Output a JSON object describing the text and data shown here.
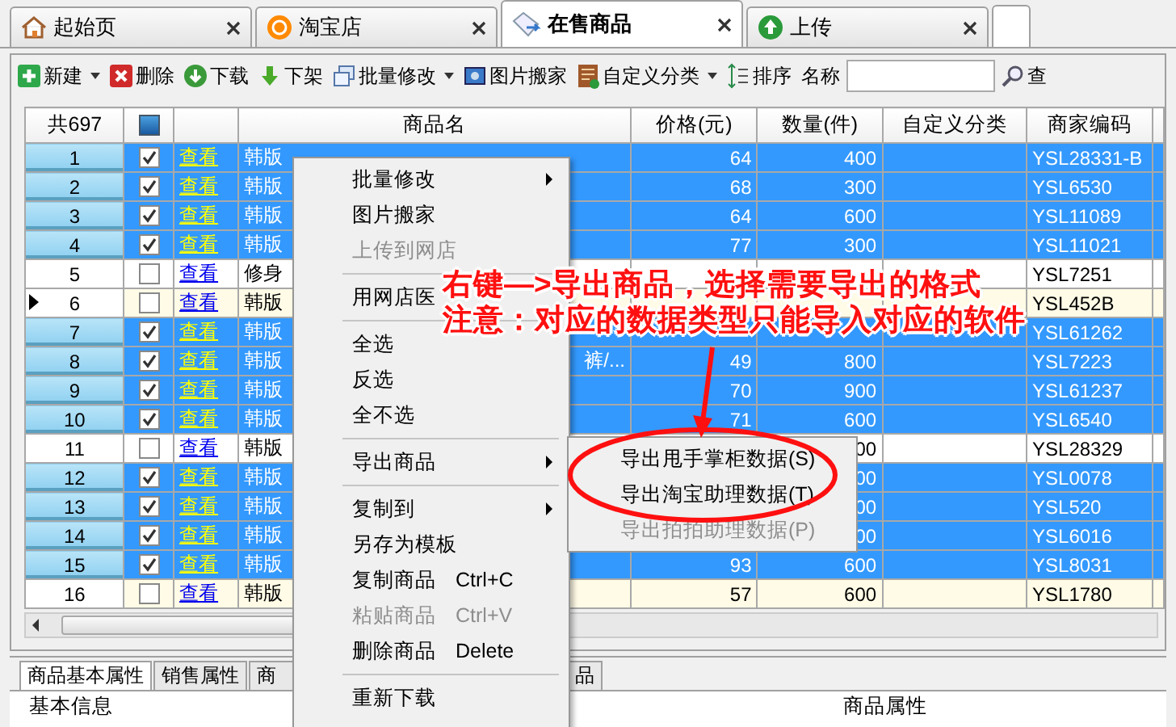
{
  "tabs": [
    {
      "label": "起始页",
      "kind": "home",
      "selected": false
    },
    {
      "label": "淘宝店",
      "kind": "shop",
      "selected": false
    },
    {
      "label": "在售商品",
      "kind": "tag",
      "selected": true
    },
    {
      "label": "上传",
      "kind": "upload",
      "selected": false
    }
  ],
  "toolbar": {
    "buttons": [
      {
        "label": "新建",
        "kind": "new",
        "dropdown": true
      },
      {
        "label": "删除",
        "kind": "delete",
        "dropdown": false
      },
      {
        "label": "下载",
        "kind": "download",
        "dropdown": false
      },
      {
        "label": "下架",
        "kind": "down",
        "dropdown": false
      },
      {
        "label": "批量修改",
        "kind": "batch",
        "dropdown": true
      },
      {
        "label": "图片搬家",
        "kind": "picture",
        "dropdown": false
      },
      {
        "label": "自定义分类",
        "kind": "category",
        "dropdown": true
      },
      {
        "label": "排序",
        "kind": "sort",
        "dropdown": false
      }
    ],
    "search_label": "名称",
    "search_button": "查"
  },
  "grid": {
    "total": "共697",
    "select_all_checked": true,
    "columns": [
      "商品名",
      "价格(元)",
      "数量(件)",
      "自定义分类",
      "商家编码"
    ],
    "rows": [
      {
        "no": "1",
        "checked": true,
        "selected": true,
        "current": false,
        "view": "查看",
        "name": "韩版",
        "price": "64",
        "qty": "400",
        "code": "YSL28331-B"
      },
      {
        "no": "2",
        "checked": true,
        "selected": true,
        "current": false,
        "view": "查看",
        "name": "韩版",
        "price": "68",
        "qty": "300",
        "code": "YSL6530"
      },
      {
        "no": "3",
        "checked": true,
        "selected": true,
        "current": false,
        "view": "查看",
        "name": "韩版",
        "price": "64",
        "qty": "600",
        "code": "YSL11089"
      },
      {
        "no": "4",
        "checked": true,
        "selected": true,
        "current": false,
        "view": "查看",
        "name": "韩版",
        "price": "77",
        "qty": "300",
        "code": "YSL11021"
      },
      {
        "no": "5",
        "checked": false,
        "selected": false,
        "current": false,
        "view": "查看",
        "name": "修身",
        "code": "YSL7251"
      },
      {
        "no": "6",
        "checked": false,
        "selected": false,
        "current": true,
        "view": "查看",
        "name": "韩版",
        "code": "YSL452B"
      },
      {
        "no": "7",
        "checked": true,
        "selected": true,
        "current": false,
        "view": "查看",
        "name": "韩版",
        "code": "YSL61262"
      },
      {
        "no": "8",
        "checked": true,
        "selected": true,
        "current": false,
        "view": "查看",
        "name": "韩版",
        "name_end": "裤/...",
        "price": "49",
        "qty": "800",
        "code": "YSL7223"
      },
      {
        "no": "9",
        "checked": true,
        "selected": true,
        "current": false,
        "view": "查看",
        "name": "韩版",
        "price": "70",
        "qty": "900",
        "code": "YSL61237"
      },
      {
        "no": "10",
        "checked": true,
        "selected": true,
        "current": false,
        "view": "查看",
        "name": "韩版",
        "price": "71",
        "qty": "600",
        "code": "YSL6540"
      },
      {
        "no": "11",
        "checked": false,
        "selected": false,
        "current": false,
        "view": "查看",
        "name": "韩版",
        "qty": "00",
        "code": "YSL28329"
      },
      {
        "no": "12",
        "checked": true,
        "selected": true,
        "current": false,
        "view": "查看",
        "name": "韩版",
        "qty": "00",
        "code": "YSL0078"
      },
      {
        "no": "13",
        "checked": true,
        "selected": true,
        "current": false,
        "view": "查看",
        "name": "韩版",
        "qty": "00",
        "code": "YSL520"
      },
      {
        "no": "14",
        "checked": true,
        "selected": true,
        "current": false,
        "view": "查看",
        "name": "韩版",
        "qty": "00",
        "code": "YSL6016"
      },
      {
        "no": "15",
        "checked": true,
        "selected": true,
        "current": false,
        "view": "查看",
        "name": "韩版",
        "price": "93",
        "qty": "600",
        "code": "YSL8031"
      },
      {
        "no": "16",
        "checked": false,
        "selected": false,
        "current": false,
        "view": "查看",
        "name": "韩版",
        "price": "57",
        "qty": "600",
        "code": "YSL1780"
      }
    ]
  },
  "context_menu": {
    "items": [
      {
        "kind": "item",
        "label": "批量修改",
        "submenu": true,
        "disabled": false
      },
      {
        "kind": "item",
        "label": "图片搬家",
        "submenu": false,
        "disabled": false
      },
      {
        "kind": "item",
        "label": "上传到网店",
        "submenu": false,
        "disabled": true
      },
      {
        "kind": "separator"
      },
      {
        "kind": "item",
        "label": "用网店医",
        "submenu": false,
        "disabled": false
      },
      {
        "kind": "separator"
      },
      {
        "kind": "item",
        "label": "全选",
        "submenu": false,
        "disabled": false
      },
      {
        "kind": "item",
        "label": "反选",
        "submenu": false,
        "disabled": false
      },
      {
        "kind": "item",
        "label": "全不选",
        "submenu": false,
        "disabled": false
      },
      {
        "kind": "separator"
      },
      {
        "kind": "item",
        "label": "导出商品",
        "submenu": true,
        "disabled": false
      },
      {
        "kind": "separator"
      },
      {
        "kind": "item",
        "label": "复制到",
        "submenu": true,
        "disabled": false
      },
      {
        "kind": "item",
        "label": "另存为模板",
        "submenu": false,
        "disabled": false
      },
      {
        "kind": "item",
        "label": "复制商品",
        "shortcut": "Ctrl+C",
        "submenu": false,
        "disabled": false
      },
      {
        "kind": "item",
        "label": "粘贴商品",
        "shortcut": "Ctrl+V",
        "submenu": false,
        "disabled": true
      },
      {
        "kind": "item",
        "label": "删除商品",
        "shortcut": "Delete",
        "submenu": false,
        "disabled": false
      },
      {
        "kind": "separator"
      },
      {
        "kind": "item",
        "label": "重新下载",
        "submenu": false,
        "disabled": false
      }
    ]
  },
  "submenu": {
    "items": [
      {
        "label": "导出甩手掌柜数据(S)",
        "disabled": false
      },
      {
        "label": "导出淘宝助理数据(T)",
        "disabled": false
      },
      {
        "label": "导出拍拍助理数据(P)",
        "disabled": true
      }
    ]
  },
  "annotation": {
    "lines": [
      "右键—>导出商品，选择需要导出的格式",
      "注意：对应的数据类型只能导入对应的软件"
    ]
  },
  "bottom": {
    "tabs": [
      {
        "label": "商品基本属性",
        "selected": true
      },
      {
        "label": "销售属性",
        "selected": false
      },
      {
        "label": "商",
        "selected": false
      },
      {
        "label": "品",
        "selected": false
      }
    ],
    "groups": [
      "基本信息",
      "商品属性"
    ]
  }
}
